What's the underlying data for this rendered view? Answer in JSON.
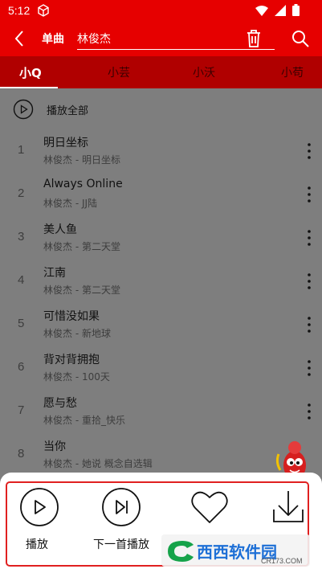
{
  "status_bar": {
    "time": "5:12",
    "cube_icon": "cube-icon",
    "wifi_icon": "wifi-icon",
    "signal_icon": "signal-icon",
    "battery_icon": "battery-icon"
  },
  "header": {
    "back_icon": "chevron-left-icon",
    "label": "单曲",
    "search_value": "林俊杰",
    "trash_icon": "trash-icon",
    "search_icon": "search-icon",
    "background": "#e60000"
  },
  "tabs": [
    {
      "label": "小Q",
      "active": true
    },
    {
      "label": "小芸",
      "active": false
    },
    {
      "label": "小沃",
      "active": false
    },
    {
      "label": "小苟",
      "active": false
    }
  ],
  "play_all": {
    "label": "播放全部",
    "icon": "play-circle-icon"
  },
  "songs": [
    {
      "index": "1",
      "title": "明日坐标",
      "subtitle": "林俊杰 - 明日坐标"
    },
    {
      "index": "2",
      "title": "Always Online",
      "subtitle": "林俊杰 - JJ陆"
    },
    {
      "index": "3",
      "title": "美人鱼",
      "subtitle": "林俊杰 - 第二天堂"
    },
    {
      "index": "4",
      "title": "江南",
      "subtitle": "林俊杰 - 第二天堂"
    },
    {
      "index": "5",
      "title": "可惜没如果",
      "subtitle": "林俊杰 - 新地球"
    },
    {
      "index": "6",
      "title": "背对背拥抱",
      "subtitle": "林俊杰 - 100天"
    },
    {
      "index": "7",
      "title": "愿与愁",
      "subtitle": "林俊杰 - 重拾_快乐"
    },
    {
      "index": "8",
      "title": "当你",
      "subtitle": "林俊杰 - 她说 概念自选辑"
    }
  ],
  "sheet": {
    "actions": [
      {
        "label": "播放",
        "icon": "play-circle-icon"
      },
      {
        "label": "下一首播放",
        "icon": "next-track-icon"
      },
      {
        "label": "",
        "icon": "heart-icon"
      },
      {
        "label": "",
        "icon": "download-icon"
      }
    ],
    "frame_color": "#e02020"
  },
  "watermark": {
    "brand": "西西软件园",
    "domain": "CR173.COM"
  }
}
